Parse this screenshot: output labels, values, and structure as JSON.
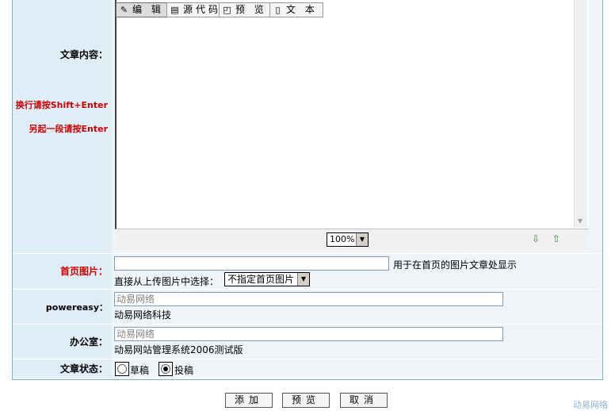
{
  "labels": {
    "content": "文章内容：",
    "hint1": "换行请按Shift+Enter",
    "hint2": "另起一段请按Enter",
    "home_image": "首页图片：",
    "powereasy": "powereasy：",
    "office": "办公室：",
    "status": "文章状态："
  },
  "toolbar": {
    "edit": "编 辑",
    "source": "源代码",
    "preview": "预 览",
    "text": "文 本",
    "zoom": "100%"
  },
  "home_image": {
    "hint": "用于在首页的图片文章处显示",
    "upload_label": "直接从上传图片中选择：",
    "select_value": "不指定首页图片"
  },
  "powereasy": {
    "value": "动易网络",
    "desc": "动易网络科技"
  },
  "office": {
    "value": "动易网络",
    "desc": "动易网站管理系统2006测试版"
  },
  "status": {
    "draft": "草稿",
    "submit": "投稿",
    "selected": "submit"
  },
  "buttons": {
    "add": "添加",
    "preview": "预览",
    "cancel": "取消"
  },
  "watermark": "动易网络",
  "icons": [
    "edit-icon",
    "source-icon",
    "preview-icon",
    "text-icon",
    "zoom-in-icon",
    "zoom-out-icon",
    "chevron-down-icon"
  ]
}
